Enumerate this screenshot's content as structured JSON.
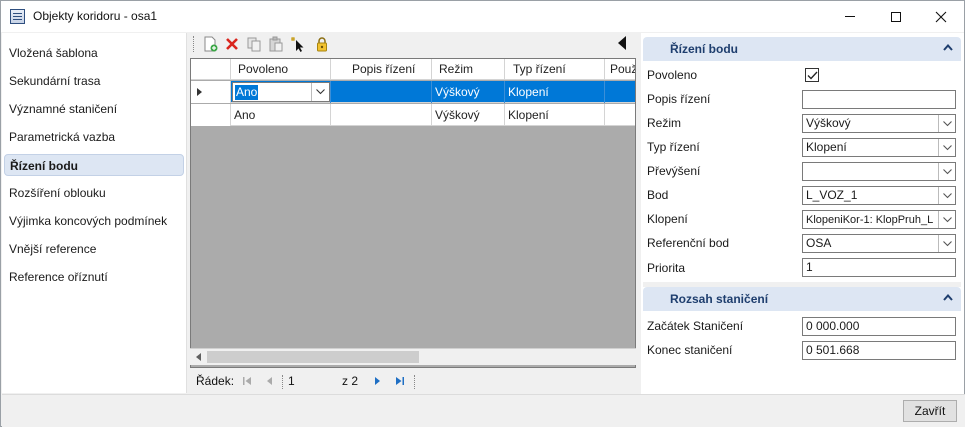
{
  "window": {
    "title": "Objekty koridoru - osa1",
    "minimize_icon": "minimize-icon",
    "maximize_icon": "maximize-icon",
    "close_icon": "close-icon"
  },
  "nav": {
    "items": [
      {
        "label": "Vložená šablona",
        "active": false
      },
      {
        "label": "Sekundární trasa",
        "active": false
      },
      {
        "label": "Významné staničení",
        "active": false
      },
      {
        "label": "Parametrická vazba",
        "active": false
      },
      {
        "label": "Řízení bodu",
        "active": true
      },
      {
        "label": "Rozšíření oblouku",
        "active": false
      },
      {
        "label": "Výjimka koncových podmínek",
        "active": false
      },
      {
        "label": "Vnější reference",
        "active": false
      },
      {
        "label": "Reference oříznutí",
        "active": false
      }
    ]
  },
  "toolbar": {
    "icons": [
      "new-row-icon",
      "delete-icon",
      "copy-icon",
      "paste-icon",
      "select-icon",
      "lock-icon"
    ]
  },
  "grid": {
    "columns": [
      "Povoleno",
      "Popis řízení",
      "Režim",
      "Typ řízení",
      "Použ"
    ],
    "rows": [
      {
        "povoleno": "Ano",
        "popis": "",
        "rezim": "Výškový",
        "typ": "Klopení",
        "selected": true
      },
      {
        "povoleno": "Ano",
        "popis": "",
        "rezim": "Výškový",
        "typ": "Klopení",
        "selected": false
      }
    ]
  },
  "pager": {
    "label": "Řádek:",
    "current": "1",
    "total": "z 2"
  },
  "panel": {
    "section1": {
      "title": "Řízení bodu",
      "povoleno_label": "Povoleno",
      "povoleno_checked": true,
      "popis_label": "Popis řízení",
      "popis_value": "",
      "rezim_label": "Režim",
      "rezim_value": "Výškový",
      "typ_label": "Typ řízení",
      "typ_value": "Klopení",
      "prevyseni_label": "Převýšení",
      "prevyseni_value": "",
      "bod_label": "Bod",
      "bod_value": "L_VOZ_1",
      "klopeni_label": "Klopení",
      "klopeni_value": "KlopeniKor-1: KlopPruh_L",
      "refbod_label": "Referenční bod",
      "refbod_value": "OSA",
      "priorita_label": "Priorita",
      "priorita_value": "1"
    },
    "section2": {
      "title": "Rozsah staničení",
      "zacatek_label": "Začátek Staničení",
      "zacatek_value": "0 000.000",
      "konec_label": "Konec staničení",
      "konec_value": "0 501.668"
    }
  },
  "footer": {
    "close_label": "Zavřít"
  }
}
